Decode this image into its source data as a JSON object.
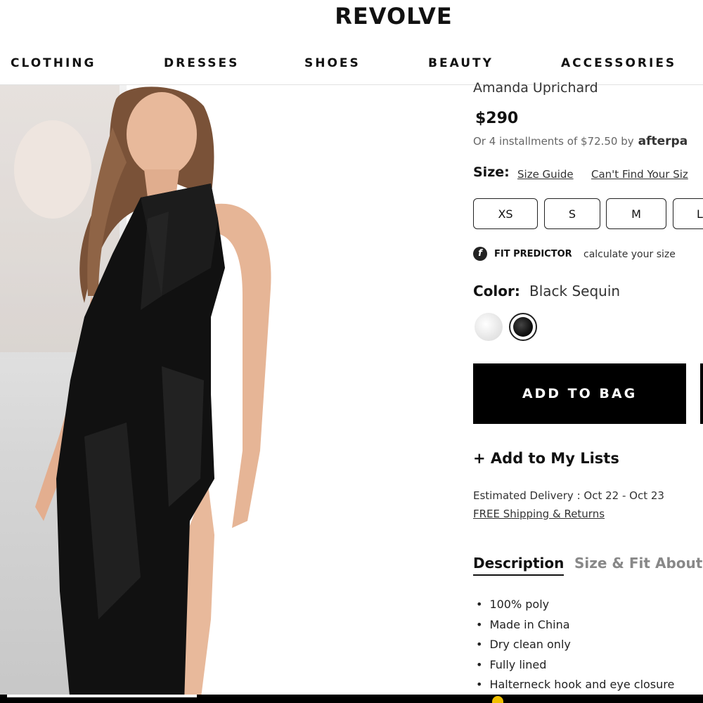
{
  "header": {
    "logo": "REVOLVE"
  },
  "nav": {
    "items": [
      "CLOTHING",
      "DRESSES",
      "SHOES",
      "BEAUTY",
      "ACCESSORIES"
    ]
  },
  "product": {
    "brand": "Amanda Uprichard",
    "price": "$290",
    "installments_text": "Or 4 installments of $72.50 by",
    "installments_provider": "afterpa",
    "size_label": "Size:",
    "size_guide": "Size Guide",
    "cant_find": "Can't Find Your Siz",
    "sizes": [
      "XS",
      "S",
      "M",
      "L"
    ],
    "fit_predictor_icon": "f",
    "fit_predictor_label": "FIT PREDICTOR",
    "fit_predictor_text": "calculate your size",
    "color_label": "Color:",
    "color_value": "Black Sequin",
    "swatches": [
      "white-sequin-swatch",
      "black-sequin-swatch"
    ],
    "add_to_bag": "ADD TO BAG",
    "add_to_lists": "+ Add to My Lists",
    "estimated_delivery": "Estimated Delivery : Oct 22 - Oct 23",
    "shipping_link": "FREE Shipping & Returns",
    "tabs": [
      "Description",
      "Size & Fit",
      "About"
    ],
    "description": [
      "100% poly",
      "Made in China",
      "Dry clean only",
      "Fully lined",
      "Halterneck hook and eye closure"
    ]
  },
  "colors": {
    "accent": "#000000",
    "text": "#111111",
    "muted": "#888888"
  }
}
